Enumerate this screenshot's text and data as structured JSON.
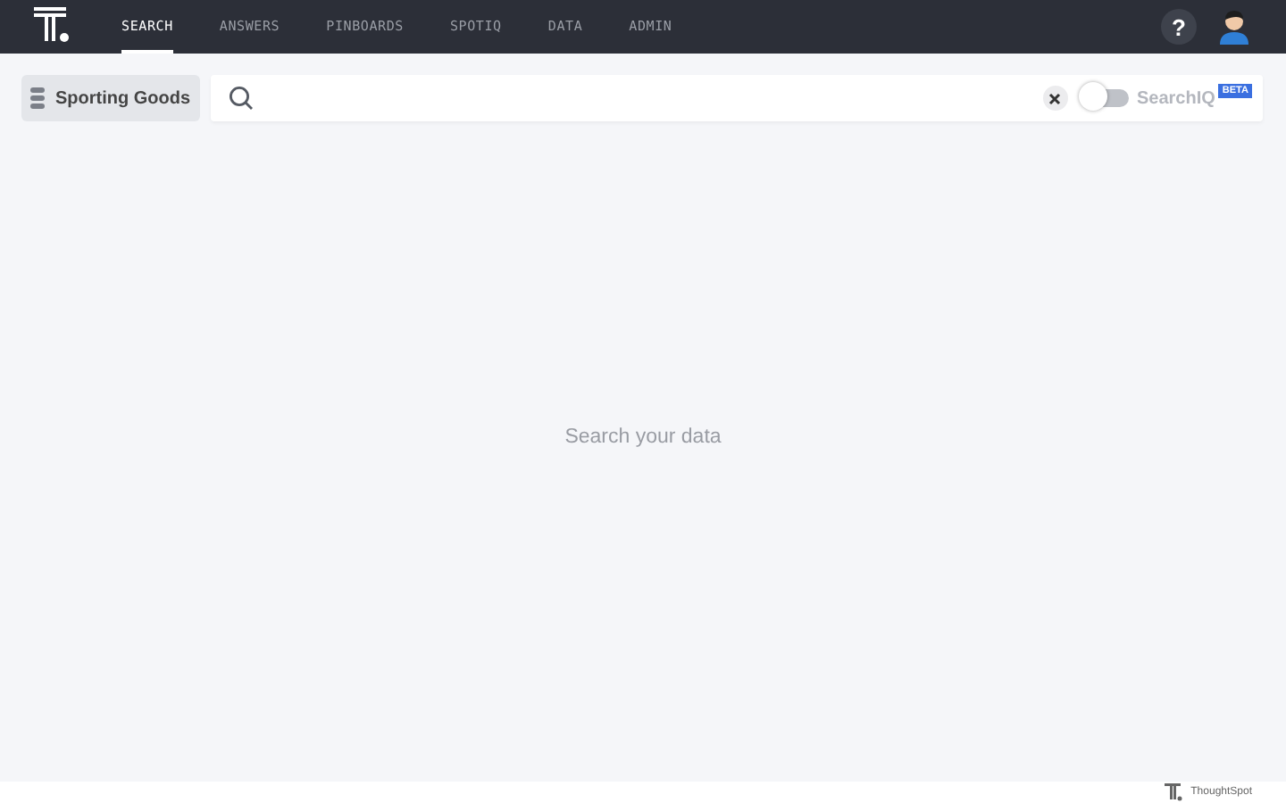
{
  "nav": {
    "tabs": [
      {
        "label": "SEARCH",
        "selected": true
      },
      {
        "label": "ANSWERS",
        "selected": false
      },
      {
        "label": "PINBOARDS",
        "selected": false
      },
      {
        "label": "SPOTIQ",
        "selected": false
      },
      {
        "label": "DATA",
        "selected": false
      },
      {
        "label": "ADMIN",
        "selected": false
      }
    ],
    "help": "?"
  },
  "source": {
    "label": "Sporting Goods"
  },
  "search": {
    "searchiq": {
      "label": "SearchIQ",
      "on": false,
      "badge": "BETA"
    }
  },
  "empty_message": "Search your data",
  "footer": {
    "brand": "ThoughtSpot"
  }
}
